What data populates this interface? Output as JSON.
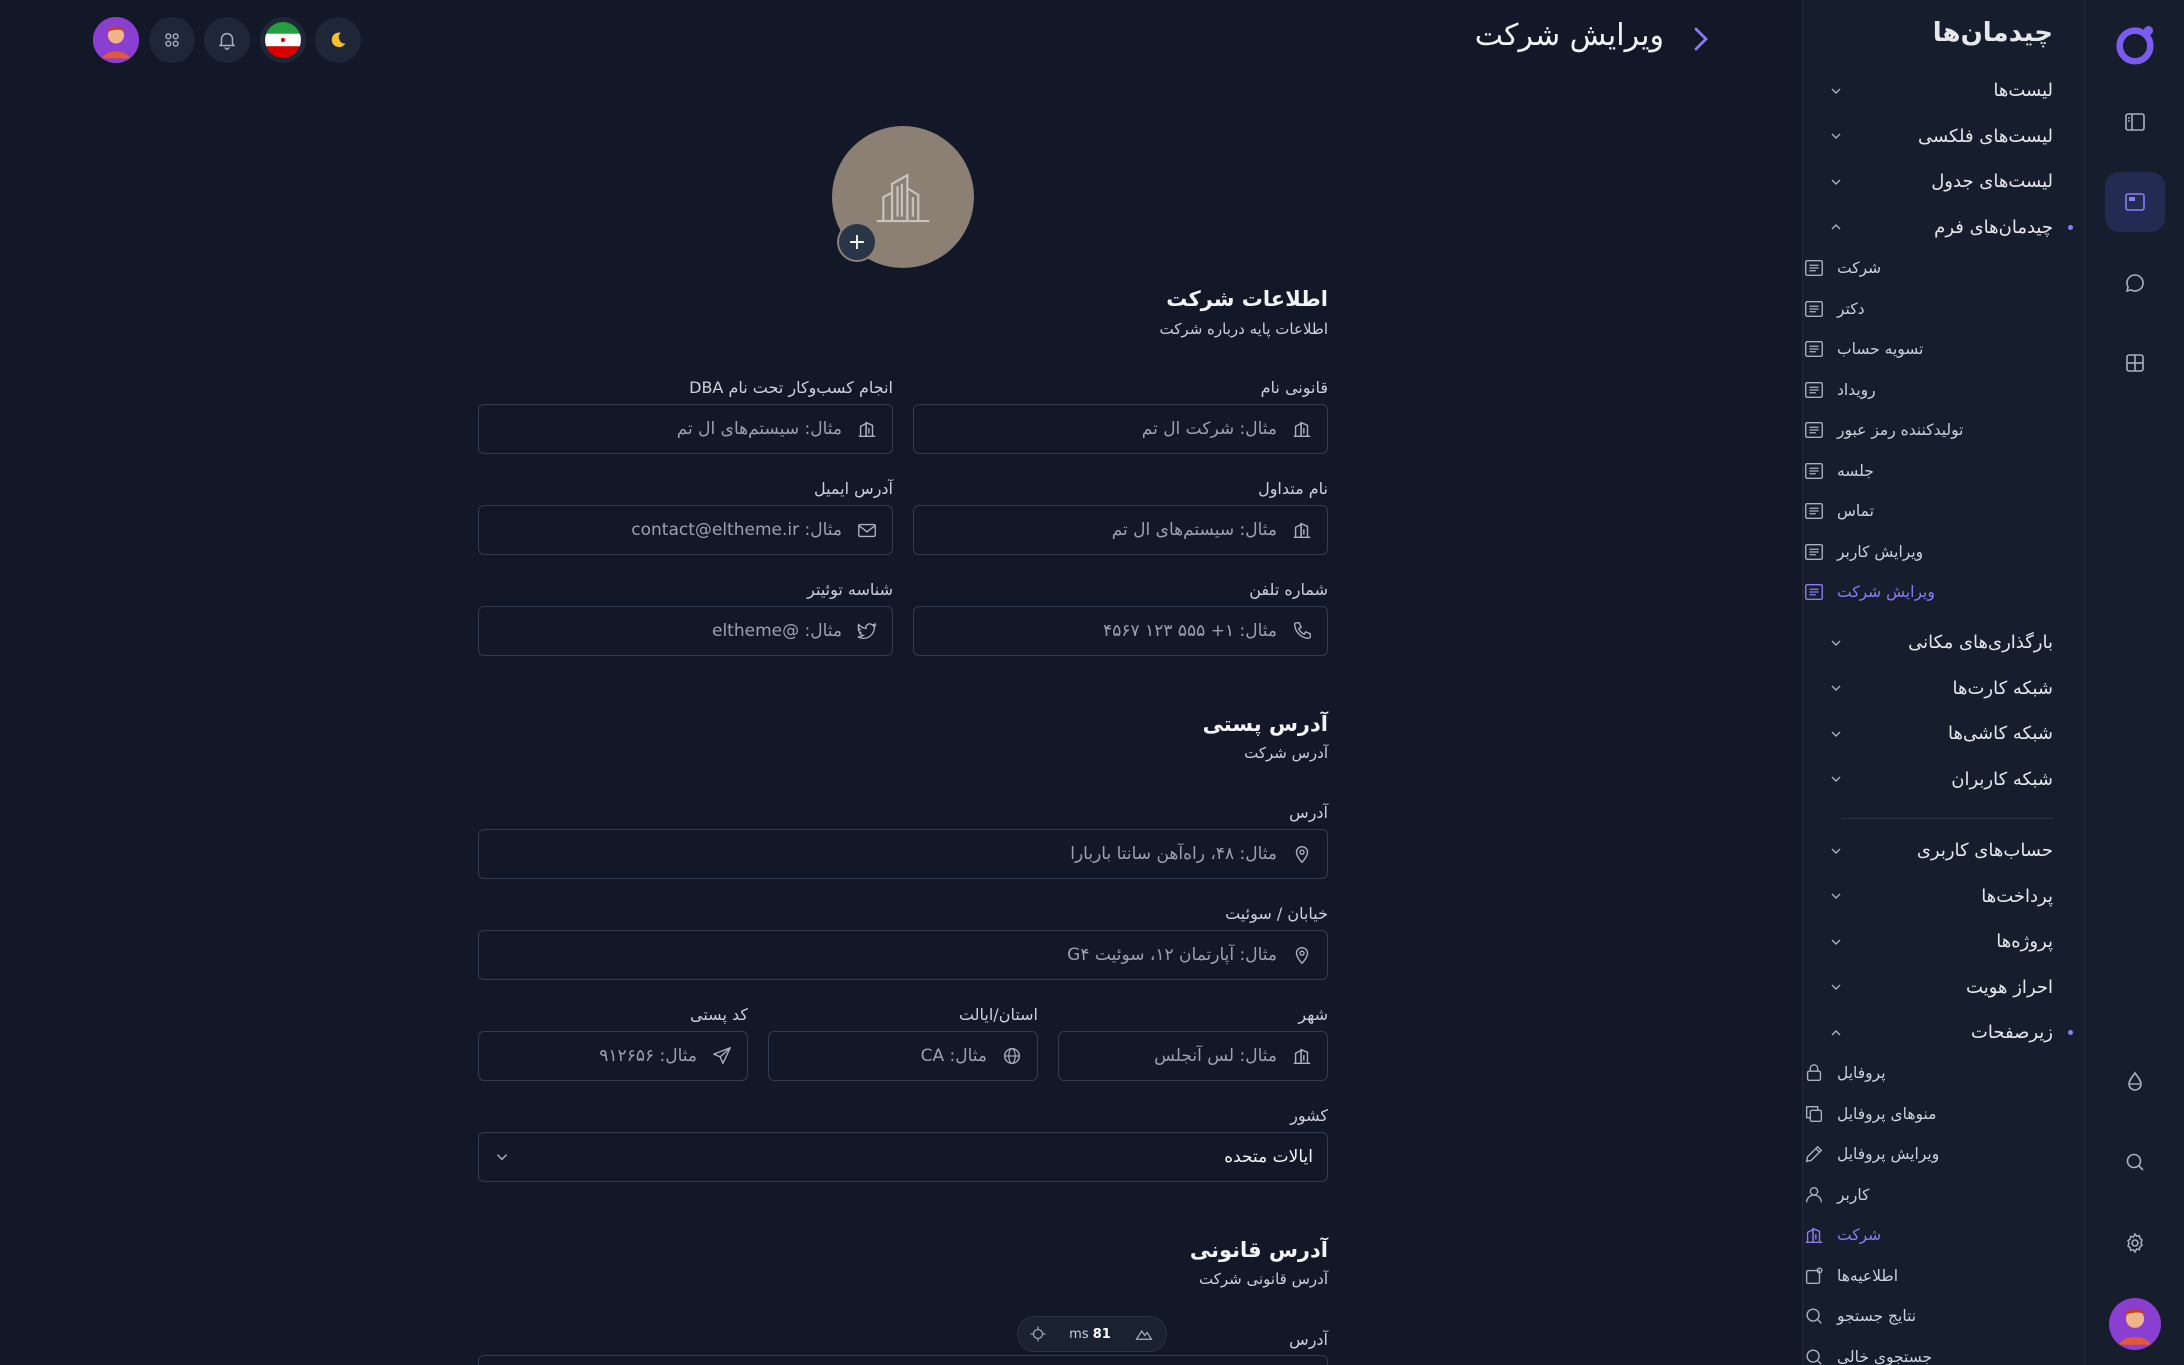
{
  "page": {
    "title": "ویرایش شرکت"
  },
  "sidebar": {
    "title": "چیدمان‌ها",
    "groups_top": [
      {
        "label": "لیست‌ها",
        "expanded": false
      },
      {
        "label": "لیست‌های فلکسی",
        "expanded": false
      },
      {
        "label": "لیست‌های جدول",
        "expanded": false
      },
      {
        "label": "چیدمان‌های فرم",
        "expanded": true
      }
    ],
    "form_items": [
      {
        "label": "شرکت",
        "icon": "list-icon"
      },
      {
        "label": "دکتر",
        "icon": "list-icon"
      },
      {
        "label": "تسویه حساب",
        "icon": "list-icon"
      },
      {
        "label": "رویداد",
        "icon": "list-icon"
      },
      {
        "label": "تولیدکننده رمز عبور",
        "icon": "list-icon"
      },
      {
        "label": "جلسه",
        "icon": "list-icon"
      },
      {
        "label": "تماس",
        "icon": "list-icon"
      },
      {
        "label": "ویرایش کاربر",
        "icon": "list-icon"
      },
      {
        "label": "ویرایش شرکت",
        "icon": "list-icon",
        "active": true
      }
    ],
    "groups_mid": [
      {
        "label": "بارگذاری‌های مکانی"
      },
      {
        "label": "شبکه کارت‌ها"
      },
      {
        "label": "شبکه کاشی‌ها"
      },
      {
        "label": "شبکه کاربران"
      }
    ],
    "groups_bottom": [
      {
        "label": "حساب‌های کاربری"
      },
      {
        "label": "پرداخت‌ها"
      },
      {
        "label": "پروژه‌ها"
      },
      {
        "label": "احراز هویت"
      },
      {
        "label": "زیرصفحات",
        "expanded": true
      }
    ],
    "subpages": [
      {
        "label": "پروفایل",
        "icon": "lock-icon"
      },
      {
        "label": "منوهای پروفایل",
        "icon": "copy-icon"
      },
      {
        "label": "ویرایش پروفایل",
        "icon": "pencil-icon"
      },
      {
        "label": "کاربر",
        "icon": "user-icon"
      },
      {
        "label": "شرکت",
        "icon": "building-icon",
        "active": true
      },
      {
        "label": "اطلاعیه‌ها",
        "icon": "notification-icon"
      },
      {
        "label": "نتایج جستجو",
        "icon": "search-icon"
      },
      {
        "label": "جستجوی خالی",
        "icon": "search-icon"
      }
    ]
  },
  "company_info": {
    "title": "اطلاعات شرکت",
    "subtitle": "اطلاعات پایه درباره شرکت",
    "legal_name": {
      "label": "قانونی نام",
      "placeholder": "مثال: شرکت ال تم"
    },
    "dba": {
      "label": "انجام کسب‌وکار تحت نام DBA",
      "placeholder": "مثال: سیستم‌های ال تم"
    },
    "common_name": {
      "label": "نام متداول",
      "placeholder": "مثال: سیستم‌های ال تم"
    },
    "email": {
      "label": "آدرس ایمیل",
      "placeholder": "مثال: contact@eltheme.ir"
    },
    "phone": {
      "label": "شماره تلفن",
      "placeholder": "مثال: ۱+ ۵۵۵ ۱۲۳ ۴۵۶۷"
    },
    "twitter": {
      "label": "شناسه توئیتر",
      "placeholder": "مثال: @eltheme"
    }
  },
  "postal_address": {
    "title": "آدرس پستی",
    "subtitle": "آدرس شرکت",
    "address": {
      "label": "آدرس",
      "placeholder": "مثال: ۴۸، راه‌آهن سانتا باربارا"
    },
    "street": {
      "label": "خیابان / سوئیت",
      "placeholder": "مثال: آپارتمان ۱۲، سوئیت G۴"
    },
    "city": {
      "label": "شهر",
      "placeholder": "مثال: لس آنجلس"
    },
    "state": {
      "label": "استان/ایالت",
      "placeholder": "مثال: CA"
    },
    "zip": {
      "label": "کد پستی",
      "placeholder": "مثال: ۹۱۲۶۵۶"
    },
    "country": {
      "label": "کشور",
      "value": "ایالات متحده"
    }
  },
  "legal_address": {
    "title": "آدرس قانونی",
    "subtitle": "آدرس قانونی شرکت",
    "address": {
      "label": "آدرس"
    }
  },
  "perf": {
    "value": "81",
    "unit": "ms"
  },
  "colors": {
    "accent": "#8b7cf6",
    "background": "#121827",
    "sidebar": "#161d2d"
  }
}
